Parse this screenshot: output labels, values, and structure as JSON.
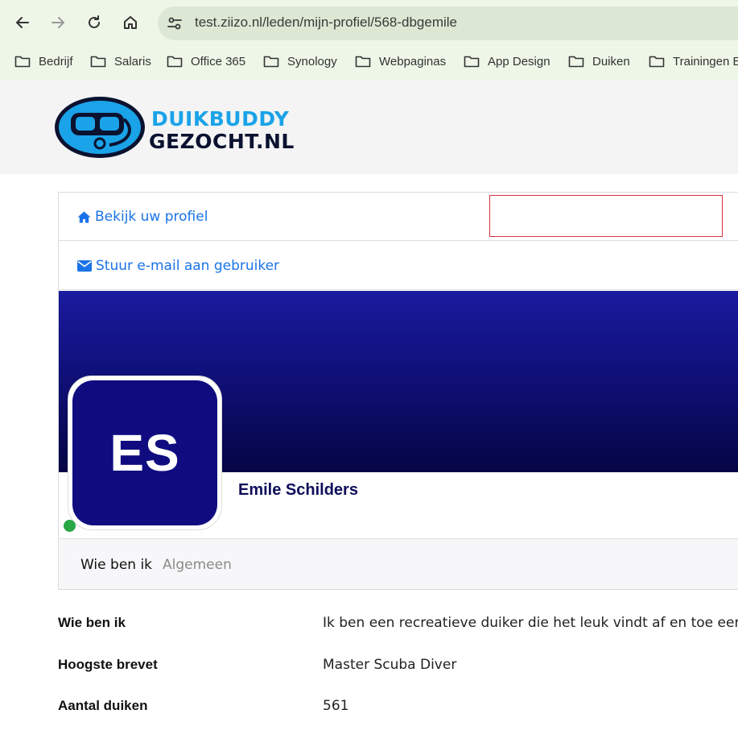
{
  "browser": {
    "url": "test.ziizo.nl/leden/mijn-profiel/568-dbgemile",
    "bookmarks": [
      "Bedrijf",
      "Salaris",
      "Office 365",
      "Synology",
      "Webpaginas",
      "App Design",
      "Duiken",
      "Trainingen E"
    ]
  },
  "site": {
    "logo_line1": "DUIKBUDDY",
    "logo_line2": "GEZOCHT.NL"
  },
  "profile": {
    "view_profile_link": "Bekijk uw profiel",
    "email_link": "Stuur e-mail aan gebruiker",
    "initials": "ES",
    "name": "Emile Schilders",
    "online": true
  },
  "tabs": [
    {
      "label": "Wie ben ik",
      "active": true
    },
    {
      "label": "Algemeen",
      "active": false
    }
  ],
  "details": [
    {
      "label": "Wie ben ik",
      "value": "Ik ben een recreatieve duiker die het leuk vindt af en toe een foto"
    },
    {
      "label": "Hoogste brevet",
      "value": "Master Scuba Diver"
    },
    {
      "label": "Aantal duiken",
      "value": "561"
    }
  ],
  "colors": {
    "link": "#1a73e8",
    "avatar_bg": "#100c80",
    "online": "#28a745",
    "highlight_box": "#d9333f"
  }
}
